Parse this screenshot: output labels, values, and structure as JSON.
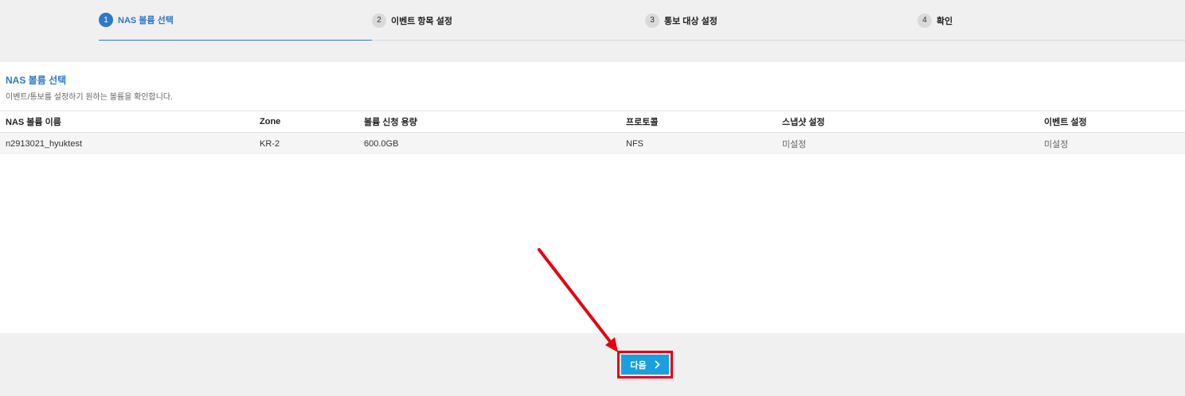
{
  "steps": [
    {
      "num": "1",
      "label": "NAS 볼륨 선택"
    },
    {
      "num": "2",
      "label": "이벤트 항목 설정"
    },
    {
      "num": "3",
      "label": "통보 대상 설정"
    },
    {
      "num": "4",
      "label": "확인"
    }
  ],
  "panel": {
    "title": "NAS 볼륨 선택",
    "description": "이벤트/통보를 설정하기 원하는 볼륨을 확인합니다."
  },
  "table": {
    "headers": [
      "NAS 볼륨 이름",
      "Zone",
      "볼륨 신청 용량",
      "프로토콜",
      "스냅샷 설정",
      "이벤트 설정"
    ],
    "rows": [
      [
        "n2913021_hyuktest",
        "KR-2",
        "600.0GB",
        "NFS",
        "미설정",
        "미설정"
      ]
    ]
  },
  "footer": {
    "next_label": "다음",
    "next_icon": "chevron-right-icon"
  },
  "colors": {
    "accent": "#2e78c7",
    "button": "#1aa0e0",
    "annotation": "#e60012"
  }
}
